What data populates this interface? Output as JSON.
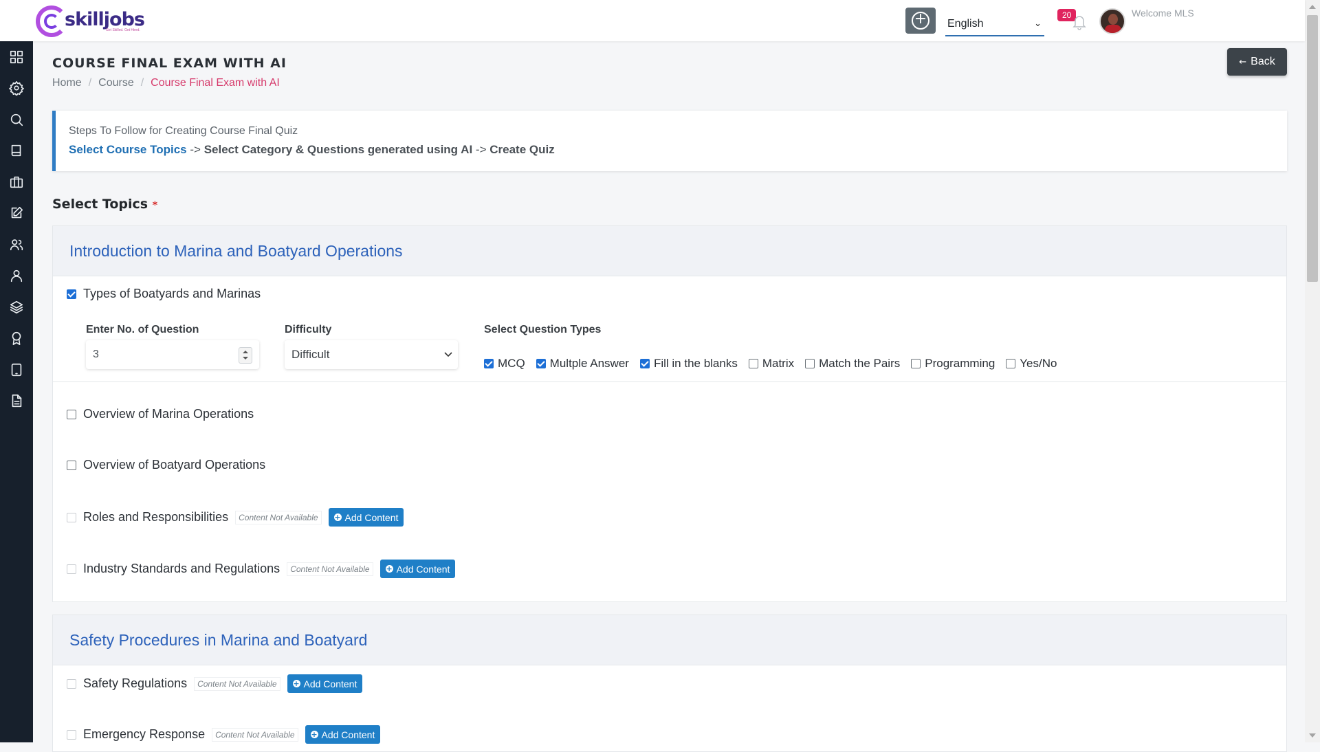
{
  "header": {
    "logo_text": "skilljobs",
    "logo_tagline": "Get Skilled. Get Hired.",
    "language": "English",
    "notification_count": "20",
    "welcome": "Welcome MLS"
  },
  "page": {
    "title": "COURSE FINAL EXAM WITH AI",
    "breadcrumb": [
      "Home",
      "Course",
      "Course Final Exam with AI"
    ],
    "back_label": "Back",
    "back_arrow": "←"
  },
  "steps": {
    "intro": "Steps To Follow for Creating Course Final Quiz",
    "step1": "Select Course Topics",
    "arrow": "->",
    "step2": "Select Category & Questions generated using AI",
    "step3": "Create Quiz"
  },
  "select_topics": {
    "label": "Select Topics",
    "required": "*"
  },
  "labels": {
    "num_questions": "Enter No. of Question",
    "difficulty": "Difficulty",
    "question_types": "Select Question Types",
    "content_na": "Content Not Available",
    "add_content": "Add Content"
  },
  "sections": [
    {
      "title": "Introduction to Marina and Boatyard Operations",
      "topics": [
        {
          "name": "Types of Boatyards and Marinas",
          "checked": true
        },
        {
          "name": "Overview of Marina Operations",
          "checked": false
        },
        {
          "name": "Overview of Boatyard Operations",
          "checked": false
        },
        {
          "name": "Roles and Responsibilities",
          "checked": false,
          "available": false
        },
        {
          "name": "Industry Standards and Regulations",
          "checked": false,
          "available": false
        }
      ]
    },
    {
      "title": "Safety Procedures in Marina and Boatyard",
      "topics": [
        {
          "name": "Safety Regulations",
          "checked": false,
          "available": false
        },
        {
          "name": "Emergency Response",
          "checked": false,
          "available": false
        }
      ]
    }
  ],
  "topic_settings": {
    "num_questions": "3",
    "difficulty": "Difficult",
    "question_types": [
      {
        "label": "MCQ",
        "checked": true
      },
      {
        "label": "Multple Answer",
        "checked": true
      },
      {
        "label": "Fill in the blanks",
        "checked": true
      },
      {
        "label": "Matrix",
        "checked": false
      },
      {
        "label": "Match the Pairs",
        "checked": false
      },
      {
        "label": "Programming",
        "checked": false
      },
      {
        "label": "Yes/No",
        "checked": false
      }
    ]
  },
  "sidebar_icons": [
    "dashboard-icon",
    "settings-icon",
    "search-icon",
    "book-icon",
    "briefcase-icon",
    "edit-icon",
    "users-icon",
    "user-icon",
    "layers-icon",
    "award-icon",
    "tablet-icon",
    "file-icon"
  ],
  "colors": {
    "accent": "#1f7fc7",
    "sidebar": "#17202c",
    "breadcrumb_active": "#d63a6b",
    "section_title": "#2d62ba",
    "badge": "#e0245e"
  }
}
